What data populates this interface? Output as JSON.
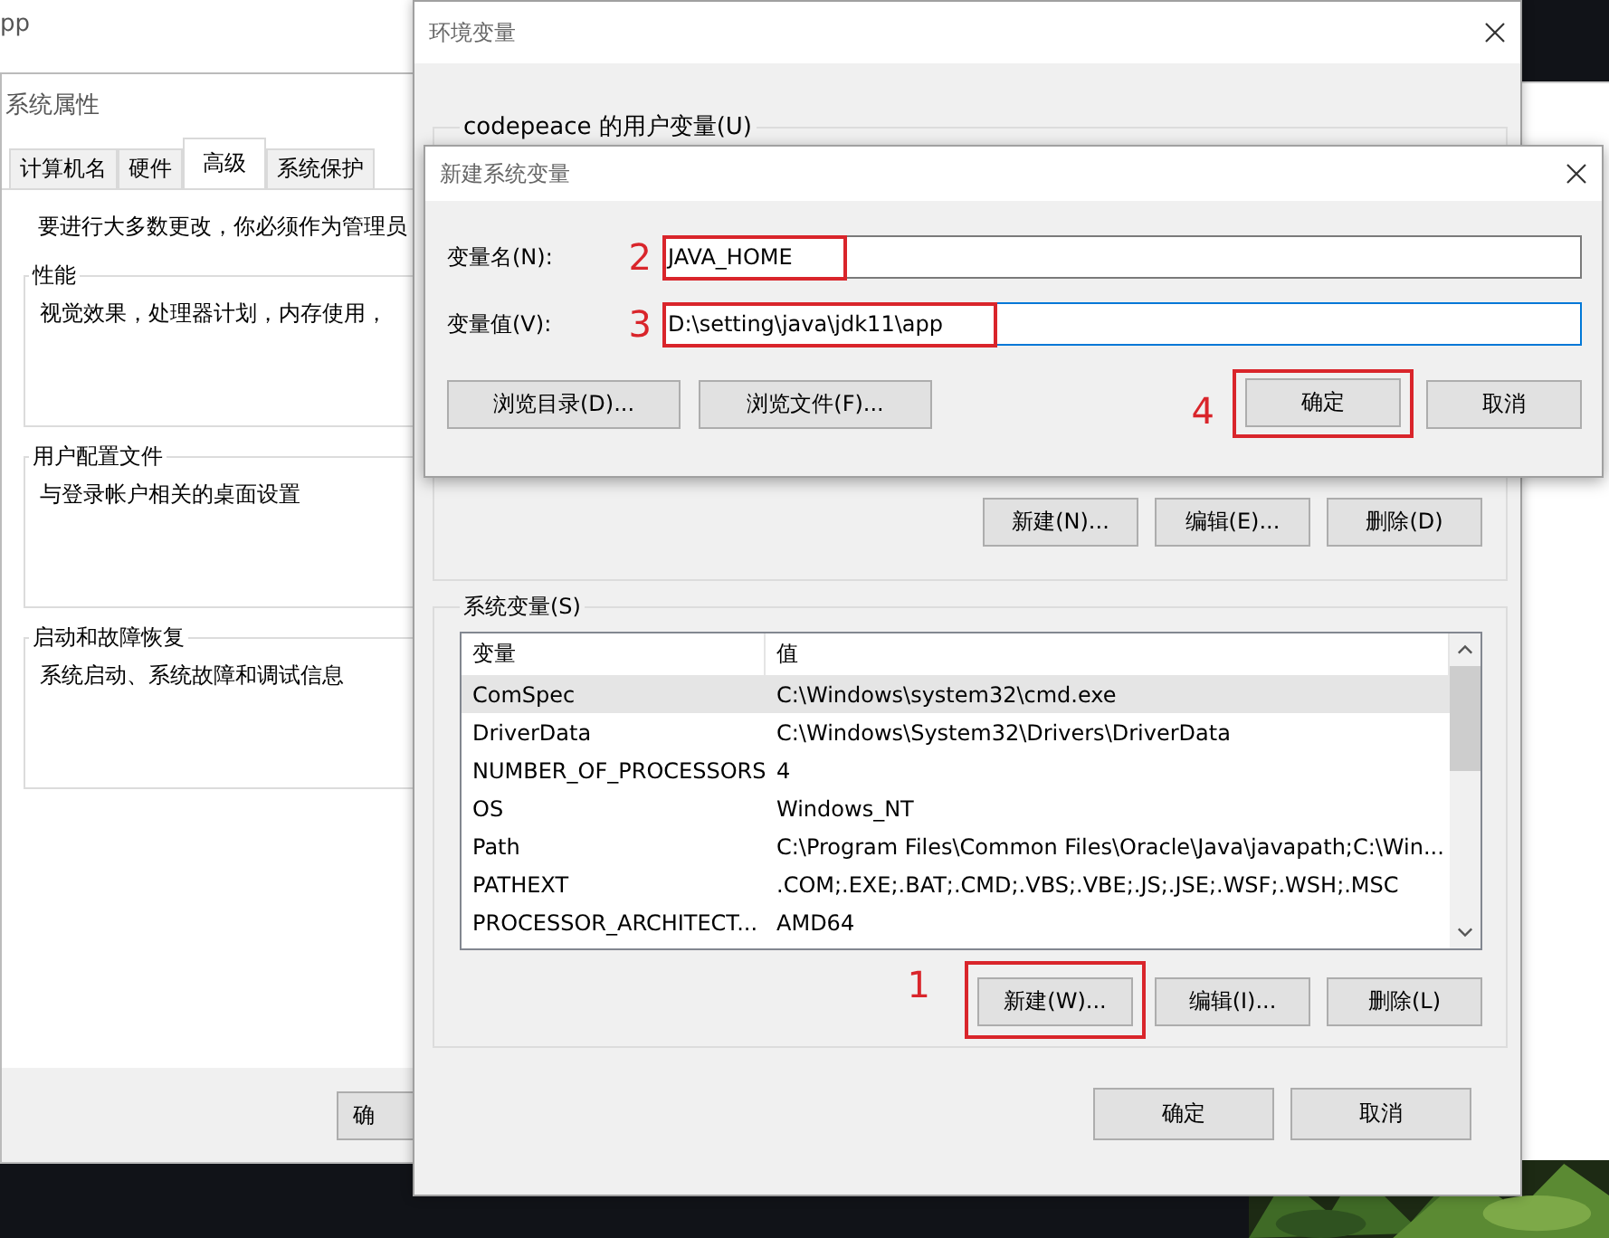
{
  "background_window": {
    "title": "pp"
  },
  "system_properties": {
    "title": "系统属性",
    "tabs": [
      {
        "label": "计算机名",
        "selected": false
      },
      {
        "label": "硬件",
        "selected": false
      },
      {
        "label": "高级",
        "selected": true
      },
      {
        "label": "系统保护",
        "selected": false
      }
    ],
    "notice": "要进行大多数更改，你必须作为管理员",
    "groups": [
      {
        "title": "性能",
        "text": "视觉效果，处理器计划，内存使用，"
      },
      {
        "title": "用户配置文件",
        "text": "与登录帐户相关的桌面设置"
      },
      {
        "title": "启动和故障恢复",
        "text": "系统启动、系统故障和调试信息"
      }
    ],
    "buttons": [
      "确"
    ]
  },
  "environment_variables": {
    "title": "环境变量",
    "user_group": {
      "title": "codepeace 的用户变量(U)",
      "buttons": [
        {
          "label": "新建(N)..."
        },
        {
          "label": "编辑(E)..."
        },
        {
          "label": "删除(D)"
        }
      ]
    },
    "system_group": {
      "title": "系统变量(S)",
      "columns": [
        "变量",
        "值"
      ],
      "rows": [
        {
          "name": "ComSpec",
          "value": "C:\\Windows\\system32\\cmd.exe",
          "selected": true
        },
        {
          "name": "DriverData",
          "value": "C:\\Windows\\System32\\Drivers\\DriverData",
          "selected": false
        },
        {
          "name": "NUMBER_OF_PROCESSORS",
          "value": "4",
          "selected": false
        },
        {
          "name": "OS",
          "value": "Windows_NT",
          "selected": false
        },
        {
          "name": "Path",
          "value": "C:\\Program Files\\Common Files\\Oracle\\Java\\javapath;C:\\Win...",
          "selected": false
        },
        {
          "name": "PATHEXT",
          "value": ".COM;.EXE;.BAT;.CMD;.VBS;.VBE;.JS;.JSE;.WSF;.WSH;.MSC",
          "selected": false
        },
        {
          "name": "PROCESSOR_ARCHITECT...",
          "value": "AMD64",
          "selected": false
        }
      ],
      "buttons": [
        {
          "label": "新建(W)...",
          "step": "1"
        },
        {
          "label": "编辑(I)..."
        },
        {
          "label": "删除(L)"
        }
      ]
    },
    "buttons": [
      {
        "label": "确定"
      },
      {
        "label": "取消"
      }
    ]
  },
  "new_variable_dialog": {
    "title": "新建系统变量",
    "fields": [
      {
        "label": "变量名(N):",
        "value": "JAVA_HOME",
        "focused": false,
        "step": "2"
      },
      {
        "label": "变量值(V):",
        "value": "D:\\setting\\java\\jdk11\\app",
        "focused": true,
        "step": "3"
      }
    ],
    "browse_buttons": [
      {
        "label": "浏览目录(D)..."
      },
      {
        "label": "浏览文件(F)..."
      }
    ],
    "buttons": [
      {
        "label": "确定",
        "step": "4"
      },
      {
        "label": "取消"
      }
    ]
  }
}
